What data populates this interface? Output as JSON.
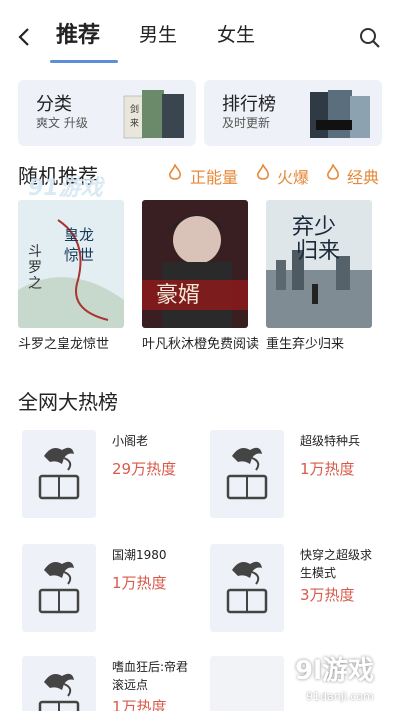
{
  "nav": {
    "tabs": [
      {
        "label": "推荐",
        "active": true
      },
      {
        "label": "男生",
        "active": false
      },
      {
        "label": "女生",
        "active": false
      }
    ]
  },
  "categories": [
    {
      "title": "分类",
      "subtitle": "爽文 升级"
    },
    {
      "title": "排行榜",
      "subtitle": "及时更新"
    }
  ],
  "random": {
    "title": "随机推荐",
    "tags": [
      "正能量",
      "火爆",
      "经典"
    ],
    "books": [
      {
        "title": "斗罗之皇龙惊世",
        "cover_text": "斗罗之 皇龙惊世"
      },
      {
        "title": "叶凡秋沐橙免费阅读",
        "cover_text": "豪婿"
      },
      {
        "title": "重生弃少归来",
        "cover_text": "弃少归来"
      }
    ]
  },
  "hot": {
    "title": "全网大热榜",
    "items": [
      {
        "name": "小阁老",
        "heat": "29万热度"
      },
      {
        "name": "超级特种兵",
        "heat": "1万热度"
      },
      {
        "name": "国潮1980",
        "heat": "1万热度"
      },
      {
        "name": "快穿之超级求生模式",
        "heat": "3万热度"
      },
      {
        "name": "嗜血狂后:帝君滚远点",
        "heat": "1万热度"
      }
    ]
  },
  "watermark": {
    "text": "9l游戏",
    "url": "91danji.com"
  },
  "colors": {
    "accent": "#5b8fd8",
    "tag": "#e6893a",
    "heat": "#d95a4a",
    "card_bg": "#eef1f7"
  }
}
